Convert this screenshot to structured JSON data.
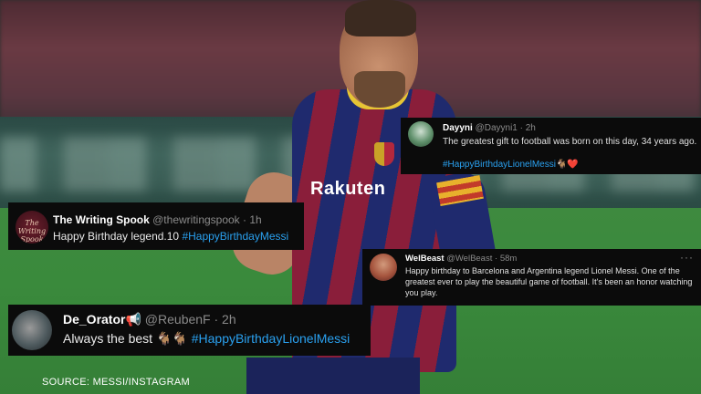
{
  "tweets": {
    "dayyni": {
      "name": "Dayyni",
      "handle": "@Dayyni1",
      "time": "· 2h",
      "text": "The greatest gift to football was born on this day, 34 years ago.",
      "hashtag": "#HappyBirthdayLionelMessi",
      "emoji": "🐐❤️"
    },
    "spook": {
      "avatar_text": "The Writing Spook",
      "name": "The Writing Spook",
      "handle": "@thewritingspook",
      "time": "· 1h",
      "text": "Happy Birthday legend.10",
      "hashtag": "#HappyBirthdayMessi"
    },
    "welbeast": {
      "name": "WelBeast",
      "handle": "@WelBeast",
      "time": "· 58m",
      "text": "Happy birthday to Barcelona and Argentina legend Lionel Messi. One of the greatest ever to play the beautiful game of football. It's been an honor watching you play.",
      "more": "···"
    },
    "orator": {
      "name": "De_Orator",
      "badge": "📢",
      "handle": "@ReubenF",
      "time": "· 2h",
      "text": "Always the best",
      "emoji": "🐐🐐",
      "hashtag": "#HappyBirthdayLionelMessi"
    }
  },
  "photo": {
    "sponsor": "Rakuten"
  },
  "source": "SOURCE: MESSI/INSTAGRAM",
  "colors": {
    "card_bg": "#0b0b0b",
    "hashtag": "#2aa1f0",
    "handle": "#8b8b8b"
  }
}
